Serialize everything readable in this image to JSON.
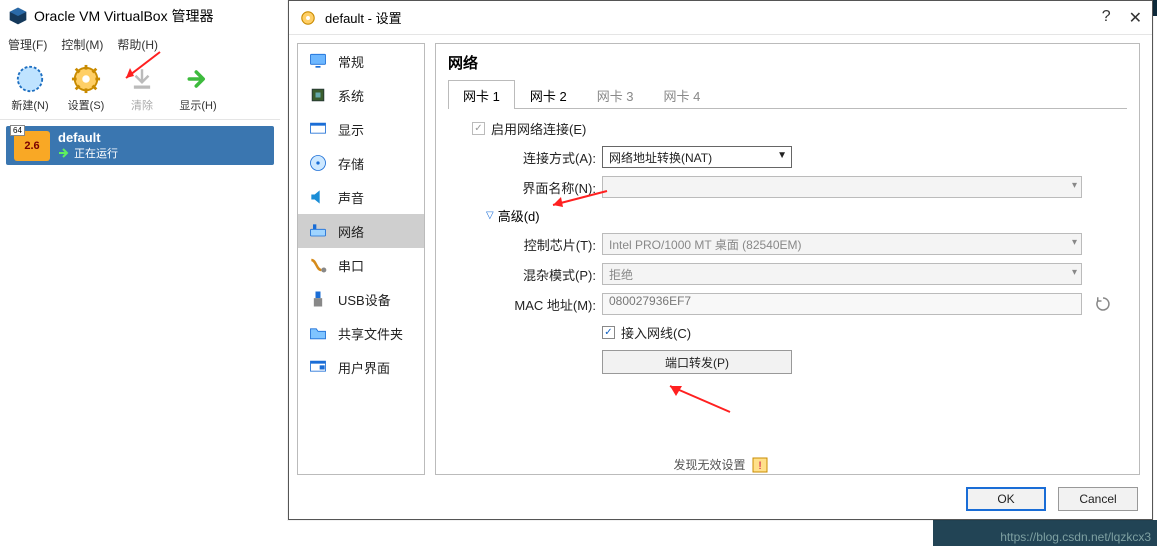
{
  "main": {
    "title": "Oracle VM VirtualBox 管理器",
    "menu": {
      "file": "管理(F)",
      "control": "控制(M)",
      "help": "帮助(H)"
    },
    "toolbar": {
      "new": "新建(N)",
      "settings": "设置(S)",
      "discard": "清除",
      "show": "显示(H)"
    },
    "vm": {
      "name": "default",
      "badge64": "64",
      "badgeVer": "2.6",
      "status": "正在运行"
    }
  },
  "dialog": {
    "title": "default - 设置",
    "help_glyph": "?",
    "close_glyph": "✕",
    "categories": {
      "general": "常规",
      "system": "系统",
      "display": "显示",
      "storage": "存储",
      "audio": "声音",
      "network": "网络",
      "serial": "串口",
      "usb": "USB设备",
      "shared": "共享文件夹",
      "ui": "用户界面"
    },
    "section_title": "网络",
    "tabs": {
      "a1": "网卡 1",
      "a2": "网卡 2",
      "a3": "网卡 3",
      "a4": "网卡 4"
    },
    "net": {
      "enable_label": "启用网络连接(E)",
      "attach_label": "连接方式(A):",
      "attach_value": "网络地址转换(NAT)",
      "ifname_label": "界面名称(N):",
      "ifname_value": "",
      "advanced": "高级(d)",
      "chip_label": "控制芯片(T):",
      "chip_value": "Intel PRO/1000 MT 桌面 (82540EM)",
      "promisc_label": "混杂模式(P):",
      "promisc_value": "拒绝",
      "mac_label": "MAC 地址(M):",
      "mac_value": "080027936EF7",
      "cable_label": "接入网线(C)",
      "portfwd_btn": "端口转发(P)"
    },
    "footer": {
      "invalid_msg": "发现无效设置",
      "ok": "OK",
      "cancel": "Cancel"
    }
  },
  "watermark": "https://blog.csdn.net/lqzkcx3"
}
